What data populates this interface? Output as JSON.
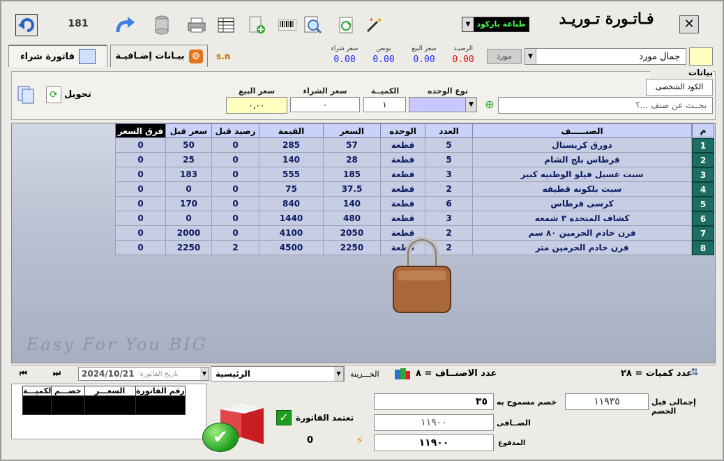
{
  "window": {
    "title": "فـاتـورة تـوريـد",
    "barcode_button": "طباعة باركود",
    "counter": "181"
  },
  "toolbar_icons": [
    "undo-icon",
    "redo-icon",
    "database-icon",
    "printer-icon",
    "grid-icon",
    "add-document-icon",
    "barcode-icon",
    "search-document-icon",
    "refresh-document-icon",
    "magic-wand-icon"
  ],
  "tabs": {
    "purchase_invoice": "فاتورة شراء",
    "extra_data": "بيـانات إضـافيـة",
    "sn": "s.n"
  },
  "summary": {
    "purchase_price_label": "سعر شراء",
    "purchase_price": "0.00",
    "bonus_label": "بونص",
    "bonus": "0.00",
    "sale_price_label": "سعر البيع",
    "sale_price": "0.00",
    "balance_label": "الرصيـد",
    "balance": "0.00"
  },
  "supplier": {
    "label": "مورد",
    "value": "جمال مورد"
  },
  "item_section": {
    "title": "بيانات الصنـــف",
    "personal_code_button": "الكود الشخصى",
    "search_placeholder": "بحــث عن صنف ...؟",
    "unit_type_label": "نوع الوحده",
    "quantity_label": "الكميــة",
    "quantity_value": "١",
    "purchase_price_label": "سعر الشراء",
    "purchase_price_value": "٠",
    "sale_price_label": "سعر البيع",
    "sale_price_value": "٠,٠٠",
    "transfer_label": "تحويل"
  },
  "table": {
    "headers": {
      "diff": "فرق السعر",
      "prev_price": "سعر قبل",
      "prev_balance": "رصيد قبل",
      "value": "القيمة",
      "price": "السعر",
      "unit": "الوحده",
      "count": "العدد",
      "item": "الصنـــــف",
      "num": "م"
    },
    "rows": [
      {
        "n": "1",
        "item": "دورق كريستال",
        "count": "5",
        "unit": "قطعة",
        "price": "57",
        "value": "285",
        "prev_balance": "0",
        "prev_price": "50",
        "diff": "0"
      },
      {
        "n": "2",
        "item": "قرطاس بلج الشام",
        "count": "5",
        "unit": "قطعة",
        "price": "28",
        "value": "140",
        "prev_balance": "0",
        "prev_price": "25",
        "diff": "0"
      },
      {
        "n": "3",
        "item": "سبت غسيل فيلو الوطنيه كبير",
        "count": "3",
        "unit": "قطعة",
        "price": "185",
        "value": "555",
        "prev_balance": "0",
        "prev_price": "183",
        "diff": "0"
      },
      {
        "n": "4",
        "item": "سبت بلكونه قطيفه",
        "count": "2",
        "unit": "قطعة",
        "price": "37.5",
        "value": "75",
        "prev_balance": "0",
        "prev_price": "0",
        "diff": "0"
      },
      {
        "n": "5",
        "item": "كرسى قرطاس",
        "count": "6",
        "unit": "قطعة",
        "price": "140",
        "value": "840",
        "prev_balance": "0",
        "prev_price": "170",
        "diff": "0"
      },
      {
        "n": "6",
        "item": "كشاف المتحده ٣ شمعه",
        "count": "3",
        "unit": "قطعة",
        "price": "480",
        "value": "1440",
        "prev_balance": "0",
        "prev_price": "0",
        "diff": "0"
      },
      {
        "n": "7",
        "item": "فرن خادم الحرمين ٨٠ سم",
        "count": "2",
        "unit": "قطعة",
        "price": "2050",
        "value": "4100",
        "prev_balance": "0",
        "prev_price": "2000",
        "diff": "0"
      },
      {
        "n": "8",
        "item": "فرن خادم الحرمين متر",
        "count": "2",
        "unit": "قطعة",
        "price": "2250",
        "value": "4500",
        "prev_balance": "2",
        "prev_price": "2250",
        "diff": "0"
      }
    ],
    "watermark": "Easy For You BIG"
  },
  "status_bar": {
    "date": "2024/10/21",
    "date_placeholder": "تاريخ الفاتورة",
    "treasury_value": "الرئيسية",
    "treasury_label": "الخـــزينة",
    "items_count_label": "عدد الاصنــاف = ٨",
    "qty_count_label": "عدد كميات = ٢٨"
  },
  "history_table": {
    "headers": [
      "رقم الفاتورة",
      "السعـــر",
      "خصـــم",
      "الكميـــة"
    ]
  },
  "totals": {
    "approve_label": "تعتمد الفاتورة",
    "zero_value": "0",
    "total_before_discount_label": "إجمالى قبل الخصم",
    "total_before_discount": "١١٩٣٥",
    "allowed_discount_label": "خصم مسموح به",
    "allowed_discount": "٣٥",
    "net_label": "الصــافى",
    "net": "١١٩٠٠",
    "paid_label": "المدفوع",
    "paid": "١١٩٠٠"
  }
}
